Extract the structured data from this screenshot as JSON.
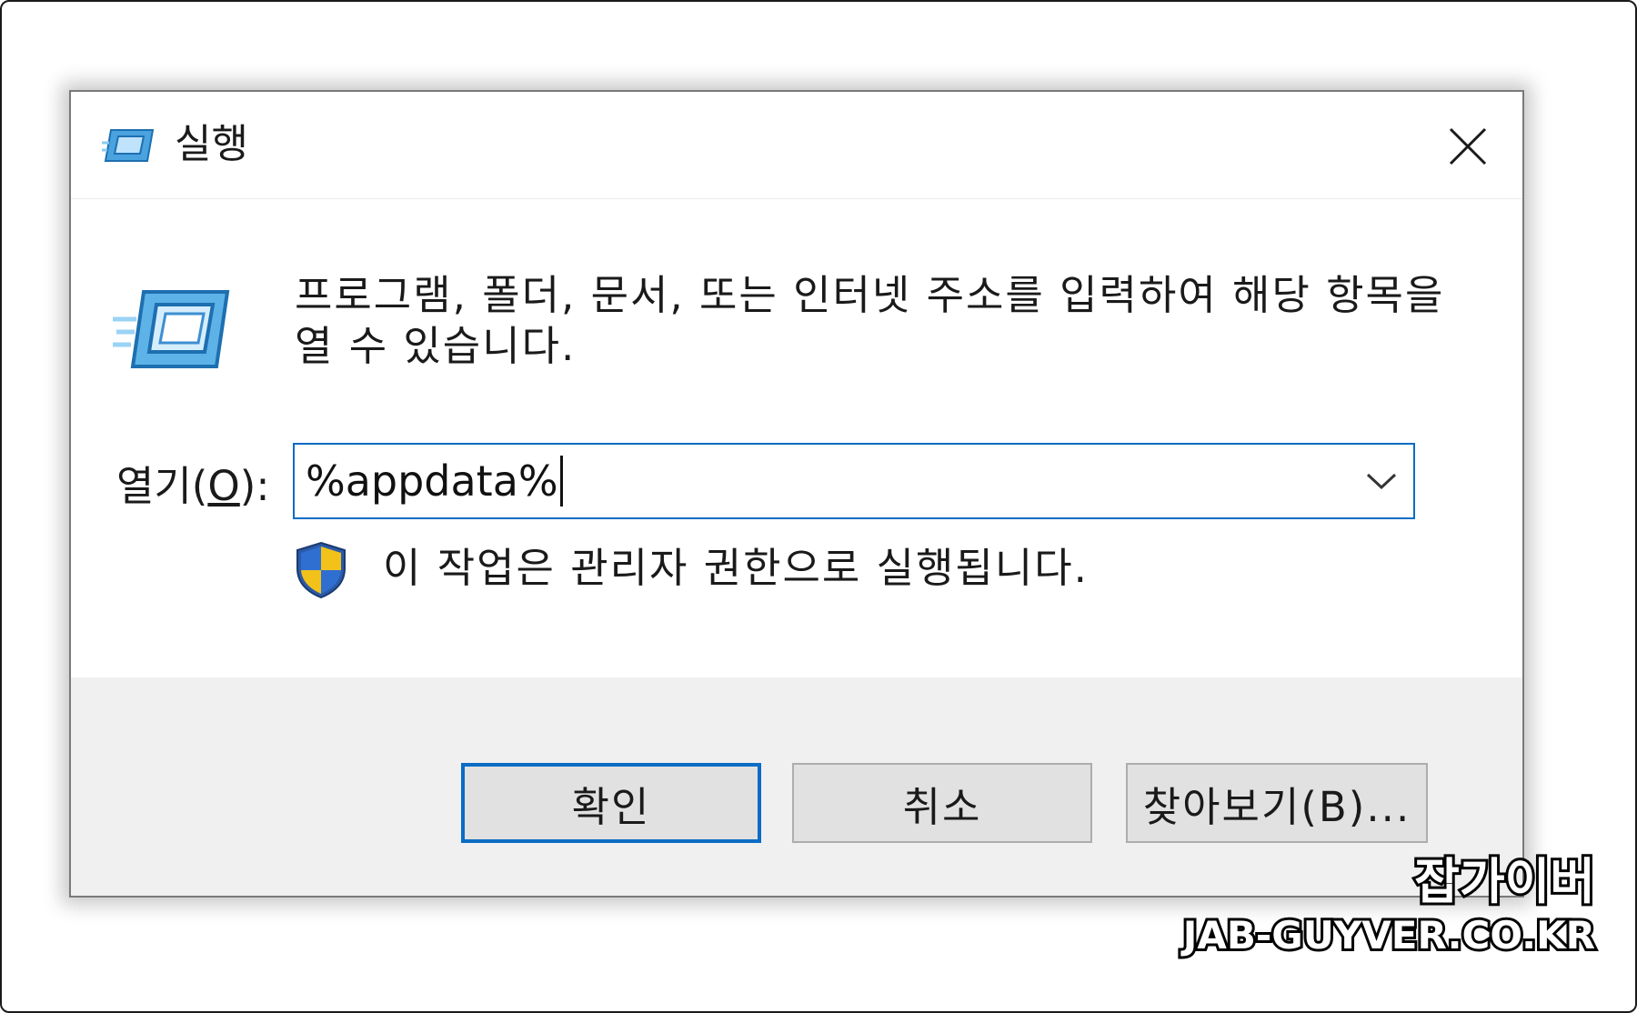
{
  "dialog": {
    "title": "실행",
    "description": "프로그램, 폴더, 문서, 또는 인터넷 주소를 입력하여 해당 항목을 열 수 있습니다.",
    "open_label_prefix": "열기(",
    "open_label_key": "O",
    "open_label_suffix": "):",
    "open_value": "%appdata%",
    "admin_note": "이 작업은 관리자 권한으로 실행됩니다.",
    "buttons": {
      "ok": "확인",
      "cancel": "취소",
      "browse": "찾아보기(B)..."
    },
    "icons": {
      "title": "run-icon",
      "main": "run-icon",
      "close": "close-icon",
      "dropdown": "chevron-down-icon",
      "shield": "uac-shield-icon"
    },
    "colors": {
      "accent": "#0a6cc4",
      "footer": "#f0f0f0",
      "button": "#e1e1e1"
    }
  },
  "watermark": {
    "korean": "잡가이버",
    "domain": "JAB-GUYVER.CO.KR"
  }
}
